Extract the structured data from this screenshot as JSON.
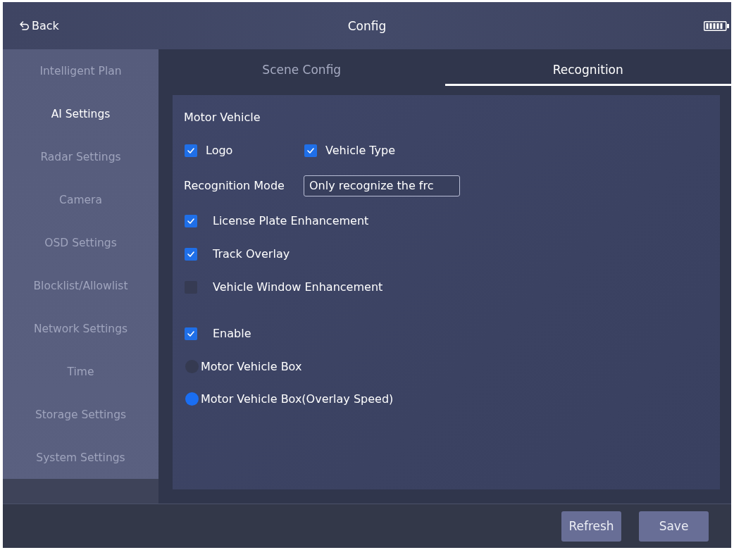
{
  "header": {
    "back_label": "Back",
    "title": "Config"
  },
  "sidebar": {
    "items": [
      {
        "label": "Intelligent Plan",
        "selected": false
      },
      {
        "label": "AI Settings",
        "selected": true
      },
      {
        "label": "Radar Settings",
        "selected": false
      },
      {
        "label": "Camera",
        "selected": false
      },
      {
        "label": "OSD Settings",
        "selected": false
      },
      {
        "label": "Blocklist/Allowlist",
        "selected": false
      },
      {
        "label": "Network Settings",
        "selected": false
      },
      {
        "label": "Time",
        "selected": false
      },
      {
        "label": "Storage Settings",
        "selected": false
      },
      {
        "label": "System Settings",
        "selected": false
      }
    ]
  },
  "tabs": [
    {
      "label": "Scene Config",
      "selected": false
    },
    {
      "label": "Recognition",
      "selected": true
    }
  ],
  "panel": {
    "title": "Motor Vehicle",
    "groups": [
      {
        "rows": [
          {
            "kind": "check_pair",
            "items": [
              {
                "label": "Logo",
                "checked": true
              },
              {
                "label": "Vehicle Type",
                "checked": true
              }
            ]
          },
          {
            "kind": "field",
            "label": "Recognition Mode",
            "value": "Only recognize the frc"
          },
          {
            "kind": "check",
            "label": "License Plate Enhancement",
            "checked": true
          },
          {
            "kind": "check",
            "label": "Track Overlay",
            "checked": true
          },
          {
            "kind": "check",
            "label": "Vehicle Window Enhancement",
            "checked": false
          }
        ]
      },
      {
        "rows": [
          {
            "kind": "check",
            "label": "Enable",
            "checked": true
          },
          {
            "kind": "radio",
            "label": "Motor Vehicle Box",
            "selected": false
          },
          {
            "kind": "radio",
            "label": "Motor Vehicle Box(Overlay Speed)",
            "selected": true
          }
        ]
      }
    ]
  },
  "footer": {
    "buttons": [
      "Refresh",
      "Save"
    ]
  }
}
